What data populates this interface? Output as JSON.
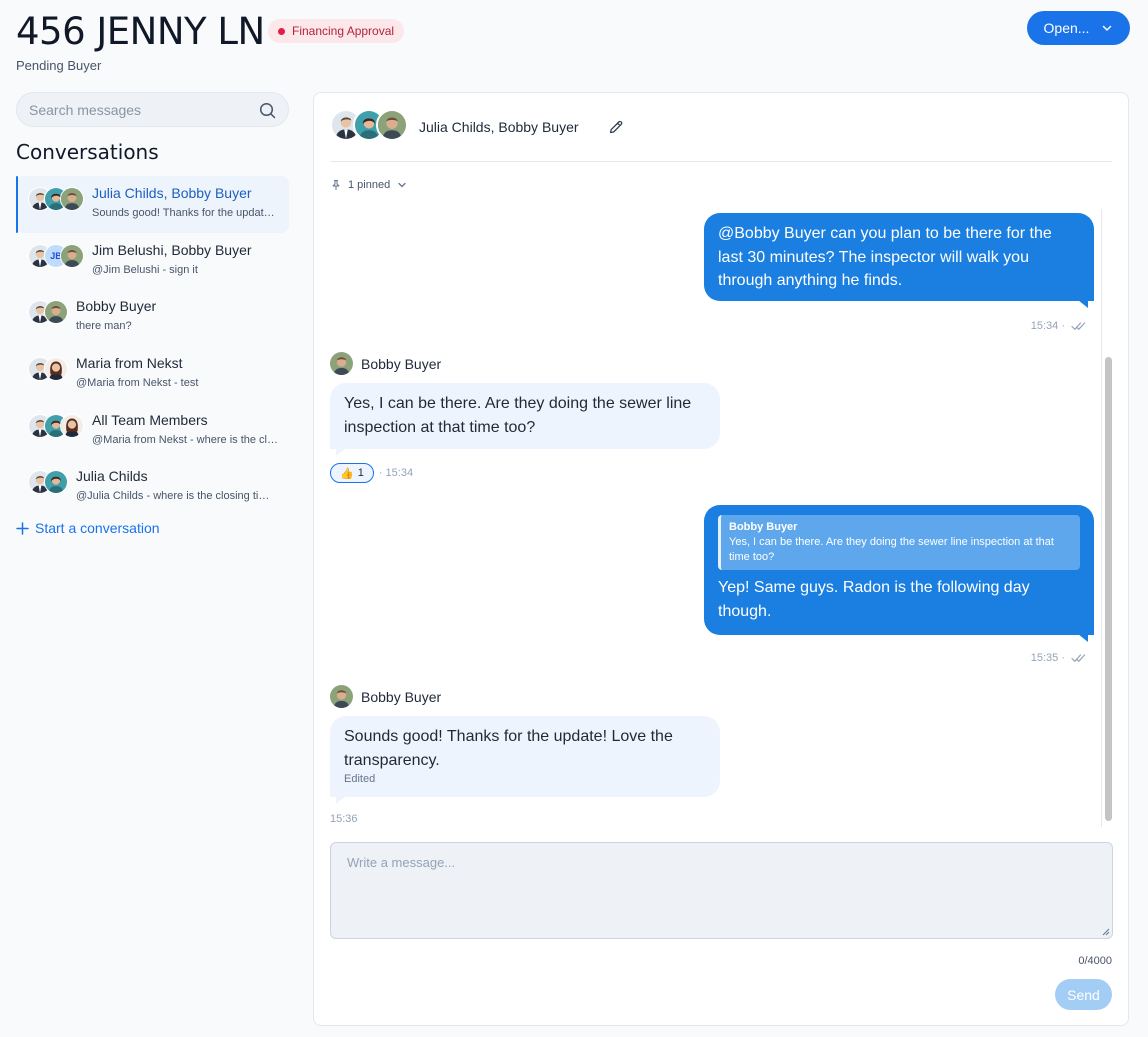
{
  "header": {
    "title": "456 JENNY LN",
    "badge": "Financing Approval",
    "subtitle": "Pending Buyer",
    "open_button": "Open..."
  },
  "sidebar": {
    "search_placeholder": "Search messages",
    "heading": "Conversations",
    "conversations": [
      {
        "name": "Julia Childs, Bobby Buyer",
        "preview": "Sounds good! Thanks for the update! Love the transparency.",
        "active": true
      },
      {
        "name": "Jim Belushi, Bobby Buyer",
        "preview": "@Jim Belushi - sign it",
        "initials": "JB"
      },
      {
        "name": "Bobby Buyer",
        "preview": "there man?"
      },
      {
        "name": "Maria from Nekst",
        "preview": "@Maria from Nekst - test"
      },
      {
        "name": "All Team Members",
        "preview": "@Maria from Nekst - where is the closing time?"
      },
      {
        "name": "Julia Childs",
        "preview": "@Julia Childs - where is the closing time?"
      }
    ],
    "start_label": "Start a conversation"
  },
  "thread": {
    "participants": "Julia Childs, Bobby Buyer",
    "pinned": "1 pinned",
    "messages": [
      {
        "direction": "out",
        "text": "@Bobby Buyer  can you plan to be there for the last 30 minutes? The inspector will walk you through anything he finds.",
        "time": "15:34 ·"
      },
      {
        "direction": "in",
        "sender": "Bobby Buyer",
        "text": "Yes, I can be there. Are they doing the sewer line inspection at that time too?",
        "reaction": "1",
        "time": "· 15:34"
      },
      {
        "direction": "out",
        "quote_sender": "Bobby Buyer",
        "quote_text": "Yes, I can be there. Are they doing the sewer line inspection at that time too?",
        "text": "Yep! Same guys. Radon is the following day though.",
        "time": "15:35 ·"
      },
      {
        "direction": "in",
        "sender": "Bobby Buyer",
        "text": "Sounds good! Thanks for the update! Love the transparency.",
        "edited": "Edited",
        "time": "15:36"
      }
    ]
  },
  "composer": {
    "placeholder": "Write a message...",
    "counter": "0/4000",
    "send_label": "Send"
  },
  "colors": {
    "accent": "#1a73e8",
    "outgoing_bubble": "#1a7fe0",
    "incoming_bubble": "#eef4fd",
    "badge_bg": "#fce7eb",
    "badge_text": "#b4233b"
  }
}
